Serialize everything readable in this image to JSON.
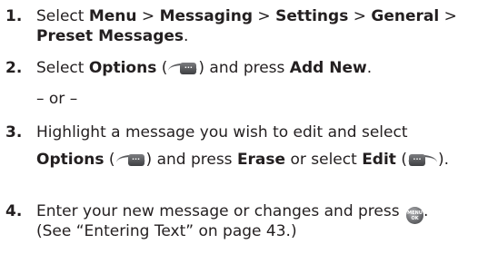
{
  "steps": [
    {
      "number": "1.",
      "lines": [
        [
          "Select ",
          "Menu",
          " > ",
          "Messaging",
          " > ",
          "Settings",
          " > ",
          "General",
          " >"
        ],
        [
          "Preset Messages",
          "."
        ]
      ]
    },
    {
      "number": "2.",
      "select": "Select ",
      "options": "Options",
      "open_paren": " (",
      "close_paren": ") and press ",
      "add_new": "Add New",
      "period": ".",
      "or": "– or –"
    },
    {
      "number": "3.",
      "line1": "Highlight a message you wish to edit and select",
      "options": "Options",
      "open_paren": " (",
      "close_paren": ") and press ",
      "erase": "Erase",
      "or_select": " or select ",
      "edit": "Edit",
      "end": ")."
    },
    {
      "number": "4.",
      "line1": "Enter your new message or changes and press ",
      "line1_end": ".",
      "line2": "(See “Entering Text” on page 43.)"
    }
  ],
  "icons": {
    "options_softkey": "right-softkey-icon",
    "edit_softkey": "left-softkey-icon",
    "ok_button": "menu-ok-button-icon",
    "softkey_label": "···",
    "ok_top": "MENU",
    "ok_bottom": "OK"
  }
}
